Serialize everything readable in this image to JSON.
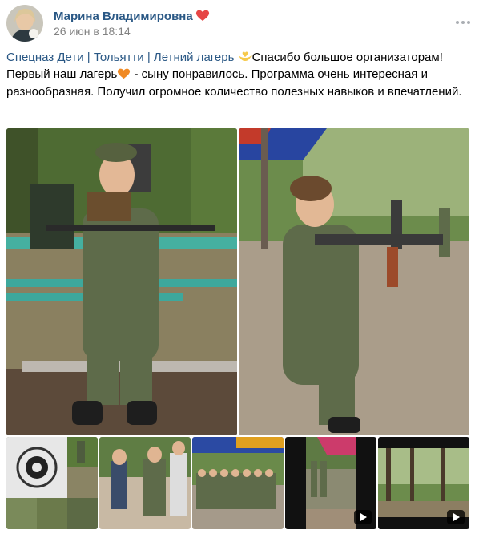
{
  "post": {
    "author": "Марина Владимировна",
    "date": "26 июн в 18:14",
    "tags": "Спецназ Дети | Тольятти | Летний лагерь",
    "text_1": "Спасибо большое организаторам! Первый наш лагерь",
    "text_2": " - сыну понравилось. Программа очень интересная и разнообразная. Получил огромное количество полезных навыков и впечатлений."
  },
  "icons": {
    "author_badge": "heart-icon",
    "thanks_emoji": "hands-heart-icon",
    "camp_emoji": "orange-heart-icon",
    "menu": "more-icon",
    "video": "play-icon"
  },
  "colors": {
    "link": "#2a5885",
    "meta": "#828282",
    "heart": "#e64646",
    "camo": "#5e6b4a"
  }
}
